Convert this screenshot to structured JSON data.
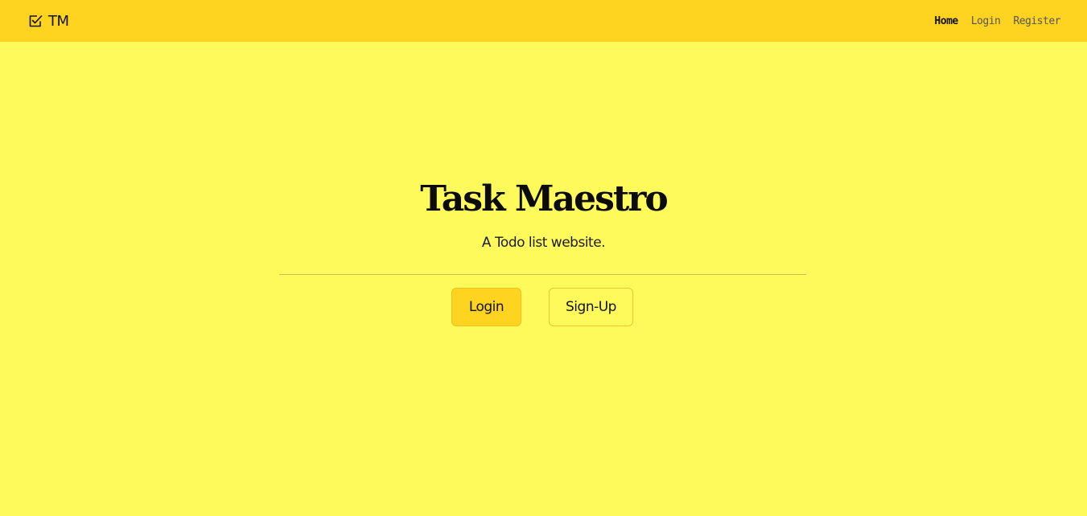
{
  "colors": {
    "background": "#fffa5c",
    "navbar": "#fed420",
    "primary_button": "#fed420"
  },
  "navbar": {
    "brand": {
      "icon": "checkbox-check-icon",
      "text": "TM"
    },
    "links": [
      {
        "label": "Home",
        "active": true
      },
      {
        "label": "Login",
        "active": false
      },
      {
        "label": "Register",
        "active": false
      }
    ]
  },
  "hero": {
    "title": "Task Maestro",
    "subtitle": "A Todo list website.",
    "buttons": {
      "login_label": "Login",
      "signup_label": "Sign-Up"
    }
  }
}
